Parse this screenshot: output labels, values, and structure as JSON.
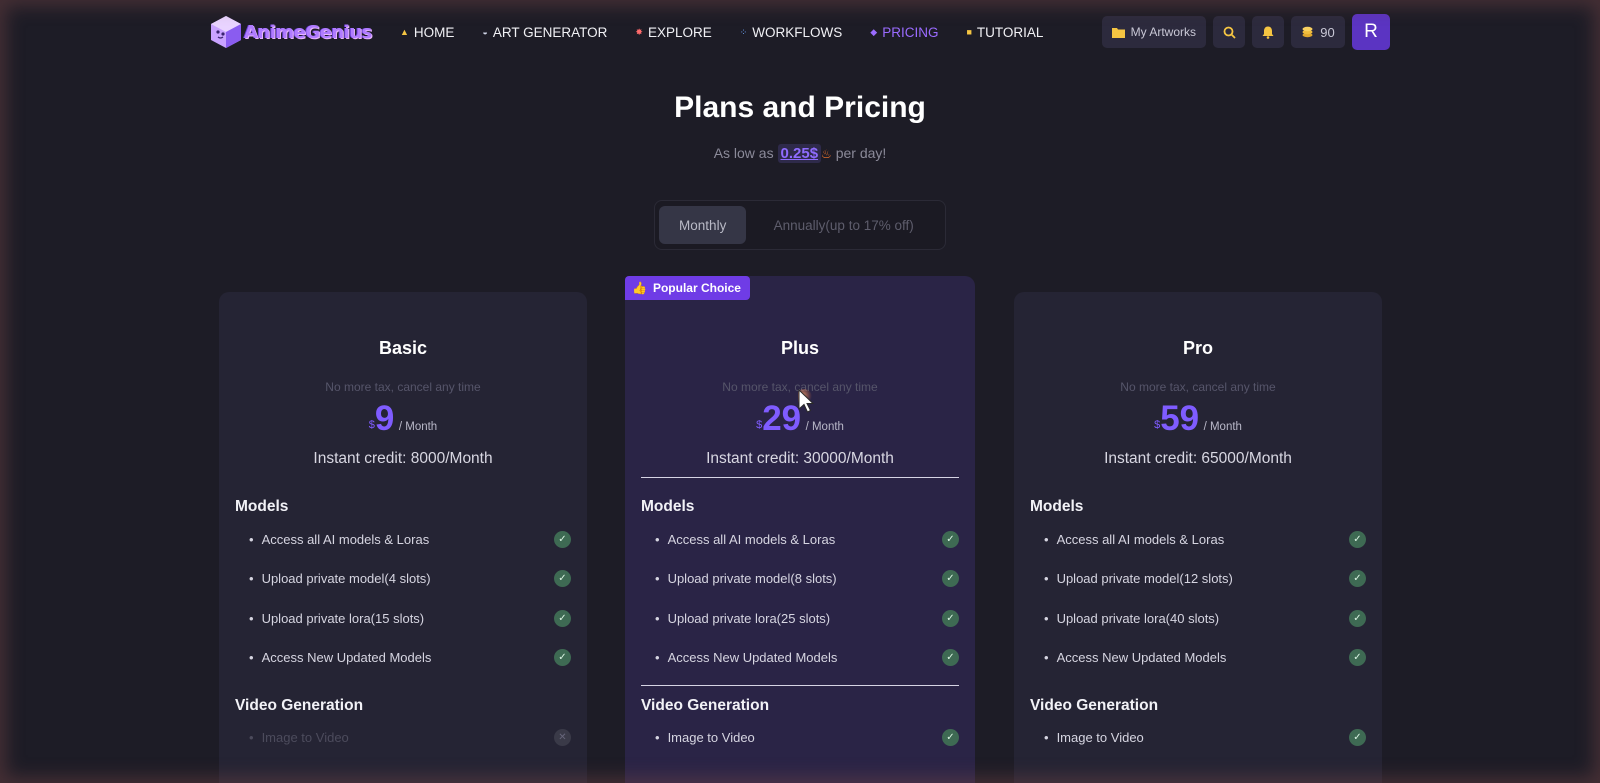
{
  "nav": {
    "brand": "AnimeGenius",
    "links": [
      {
        "label": "HOME",
        "icon": "home-icon",
        "glyph": "▲",
        "color": "#f5c542"
      },
      {
        "label": "ART GENERATOR",
        "icon": "palette-icon",
        "glyph": "◒",
        "color": "#cfd4e6"
      },
      {
        "label": "EXPLORE",
        "icon": "rocket-icon",
        "glyph": "✸",
        "color": "#ff6b6b"
      },
      {
        "label": "WORKFLOWS",
        "icon": "workflow-icon",
        "glyph": "⁘",
        "color": "#6fa8ff"
      },
      {
        "label": "PRICING",
        "icon": "gem-icon",
        "glyph": "◆",
        "color": "#9a6bff",
        "active": true
      },
      {
        "label": "TUTORIAL",
        "icon": "note-icon",
        "glyph": "■",
        "color": "#f5c542"
      }
    ],
    "my_artworks": "My Artworks",
    "credits": "90",
    "avatar_letter": "R"
  },
  "header": {
    "title": "Plans and Pricing",
    "subtitle_pre": "As low as",
    "subtitle_price": "0.25$",
    "subtitle_post": "per day!"
  },
  "billing_toggle": {
    "monthly": "Monthly",
    "annually": "Annually(up to 17% off)"
  },
  "plans": [
    {
      "name": "Basic",
      "note": "No more tax, cancel any time",
      "currency": "$",
      "price": "9",
      "period": "/ Month",
      "credit": "Instant credit: 8000/Month",
      "models_title": "Models",
      "models": [
        {
          "label": "Access all AI models & Loras",
          "included": true
        },
        {
          "label": "Upload private model(4 slots)",
          "included": true
        },
        {
          "label": "Upload private lora(15 slots)",
          "included": true
        },
        {
          "label": "Access New Updated Models",
          "included": true
        }
      ],
      "video_title": "Video Generation",
      "video": [
        {
          "label": "Image to Video",
          "included": false
        }
      ]
    },
    {
      "name": "Plus",
      "badge": "Popular Choice",
      "note": "No more tax, cancel any time",
      "currency": "$",
      "price": "29",
      "period": "/ Month",
      "credit": "Instant credit: 30000/Month",
      "models_title": "Models",
      "models": [
        {
          "label": "Access all AI models & Loras",
          "included": true
        },
        {
          "label": "Upload private model(8 slots)",
          "included": true
        },
        {
          "label": "Upload private lora(25 slots)",
          "included": true
        },
        {
          "label": "Access New Updated Models",
          "included": true
        }
      ],
      "video_title": "Video Generation",
      "video": [
        {
          "label": "Image to Video",
          "included": true
        }
      ]
    },
    {
      "name": "Pro",
      "note": "No more tax, cancel any time",
      "currency": "$",
      "price": "59",
      "period": "/ Month",
      "credit": "Instant credit: 65000/Month",
      "models_title": "Models",
      "models": [
        {
          "label": "Access all AI models & Loras",
          "included": true
        },
        {
          "label": "Upload private model(12 slots)",
          "included": true
        },
        {
          "label": "Upload private lora(40 slots)",
          "included": true
        },
        {
          "label": "Access New Updated Models",
          "included": true
        }
      ],
      "video_title": "Video Generation",
      "video": [
        {
          "label": "Image to Video",
          "included": true
        }
      ]
    }
  ],
  "colors": {
    "accent": "#7f5cff",
    "background": "#1d1c26",
    "card": "#252434",
    "card_featured": "#2a2446",
    "check": "#3e6a53"
  }
}
